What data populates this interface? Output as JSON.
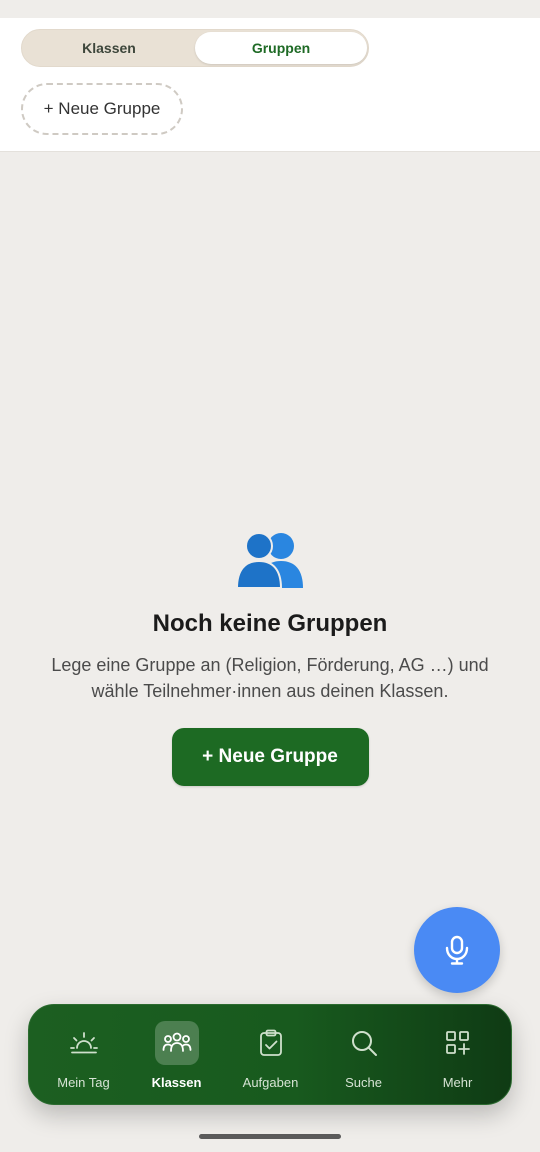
{
  "segments": {
    "klassen": "Klassen",
    "gruppen": "Gruppen",
    "selected": "Gruppen"
  },
  "toolbar": {
    "new_group_label": "+ Neue Gruppe"
  },
  "empty_state": {
    "icon": "people-icon",
    "title": "Noch keine Gruppen",
    "description": "Lege eine Gruppe an (Religion, Förderung, AG …) und wähle Teilnehmer·innen aus deinen Klassen.",
    "button_label": "+ Neue Gruppe"
  },
  "fab": {
    "icon": "microphone-icon"
  },
  "nav": {
    "items": [
      {
        "label": "Mein Tag",
        "icon": "sunrise-icon"
      },
      {
        "label": "Klassen",
        "icon": "group-icon",
        "active": true
      },
      {
        "label": "Aufgaben",
        "icon": "clipboard-check-icon"
      },
      {
        "label": "Suche",
        "icon": "search-icon"
      },
      {
        "label": "Mehr",
        "icon": "apps-add-icon"
      }
    ]
  },
  "colors": {
    "background": "#efedea",
    "primary_green": "#1d6a23",
    "fab_blue": "#4a8af4",
    "people_icon_blue": "#1e73c8"
  }
}
